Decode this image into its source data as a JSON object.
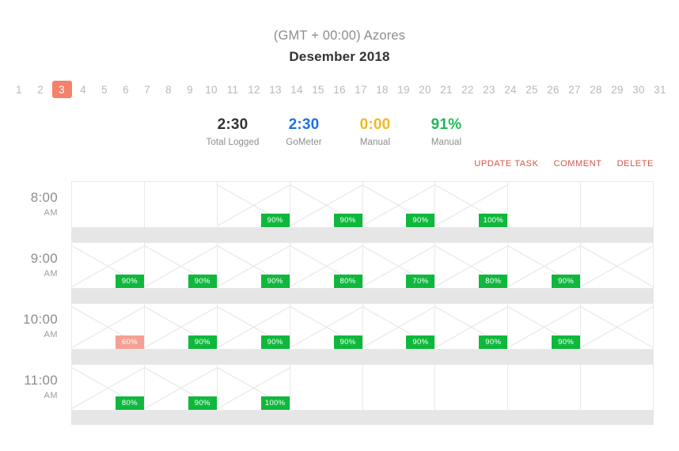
{
  "header": {
    "timezone": "(GMT + 00:00) Azores",
    "month": "Desember 2018"
  },
  "day_strip": {
    "selected": "3",
    "days": [
      "1",
      "2",
      "3",
      "4",
      "5",
      "6",
      "7",
      "8",
      "9",
      "10",
      "11",
      "12",
      "13",
      "14",
      "15",
      "16",
      "17",
      "18",
      "19",
      "20",
      "21",
      "22",
      "23",
      "24",
      "25",
      "26",
      "27",
      "28",
      "29",
      "30",
      "31"
    ]
  },
  "stats": [
    {
      "value": "2:30",
      "label": "Total Logged",
      "color": "#333333"
    },
    {
      "value": "2:30",
      "label": "GoMeter",
      "color": "#1a73e8"
    },
    {
      "value": "0:00",
      "label": "Manual",
      "color": "#f2bb1d"
    },
    {
      "value": "91%",
      "label": "Manual",
      "color": "#1db954"
    }
  ],
  "actions": [
    {
      "label": "UPDATE TASK"
    },
    {
      "label": "COMMENT"
    },
    {
      "label": "DELETE"
    }
  ],
  "colors": {
    "accent": "#f4816a",
    "action_link": "#d2564a",
    "badge_good": "#0fb83c",
    "badge_bad": "#f4a095",
    "grid_line": "#e9e9e9",
    "spacer": "#e6e6e6",
    "muted_text": "#8d8d8d"
  },
  "timeline": {
    "rows": [
      {
        "time": "8:00",
        "ampm": "AM",
        "cells": [
          {
            "crossed": false,
            "badge": null
          },
          {
            "crossed": false,
            "badge": null
          },
          {
            "crossed": true,
            "badge": "90%",
            "status": "good"
          },
          {
            "crossed": true,
            "badge": "90%",
            "status": "good"
          },
          {
            "crossed": true,
            "badge": "90%",
            "status": "good"
          },
          {
            "crossed": true,
            "badge": "100%",
            "status": "good"
          },
          {
            "crossed": false,
            "badge": null
          },
          {
            "crossed": false,
            "badge": null
          }
        ]
      },
      {
        "time": "9:00",
        "ampm": "AM",
        "cells": [
          {
            "crossed": true,
            "badge": "90%",
            "status": "good"
          },
          {
            "crossed": true,
            "badge": "90%",
            "status": "good"
          },
          {
            "crossed": true,
            "badge": "90%",
            "status": "good"
          },
          {
            "crossed": true,
            "badge": "80%",
            "status": "good"
          },
          {
            "crossed": true,
            "badge": "70%",
            "status": "good"
          },
          {
            "crossed": true,
            "badge": "80%",
            "status": "good"
          },
          {
            "crossed": true,
            "badge": "90%",
            "status": "good"
          },
          {
            "crossed": true,
            "badge": null
          }
        ]
      },
      {
        "time": "10:00",
        "ampm": "AM",
        "cells": [
          {
            "crossed": true,
            "badge": "60%",
            "status": "bad"
          },
          {
            "crossed": true,
            "badge": "90%",
            "status": "good"
          },
          {
            "crossed": true,
            "badge": "90%",
            "status": "good"
          },
          {
            "crossed": true,
            "badge": "90%",
            "status": "good"
          },
          {
            "crossed": true,
            "badge": "90%",
            "status": "good"
          },
          {
            "crossed": true,
            "badge": "90%",
            "status": "good"
          },
          {
            "crossed": true,
            "badge": "90%",
            "status": "good"
          },
          {
            "crossed": true,
            "badge": null
          }
        ]
      },
      {
        "time": "11:00",
        "ampm": "AM",
        "cells": [
          {
            "crossed": true,
            "badge": "80%",
            "status": "good"
          },
          {
            "crossed": true,
            "badge": "90%",
            "status": "good"
          },
          {
            "crossed": true,
            "badge": "100%",
            "status": "good"
          },
          {
            "crossed": false,
            "badge": null
          },
          {
            "crossed": false,
            "badge": null
          },
          {
            "crossed": false,
            "badge": null
          },
          {
            "crossed": false,
            "badge": null
          },
          {
            "crossed": false,
            "badge": null
          }
        ]
      }
    ]
  }
}
